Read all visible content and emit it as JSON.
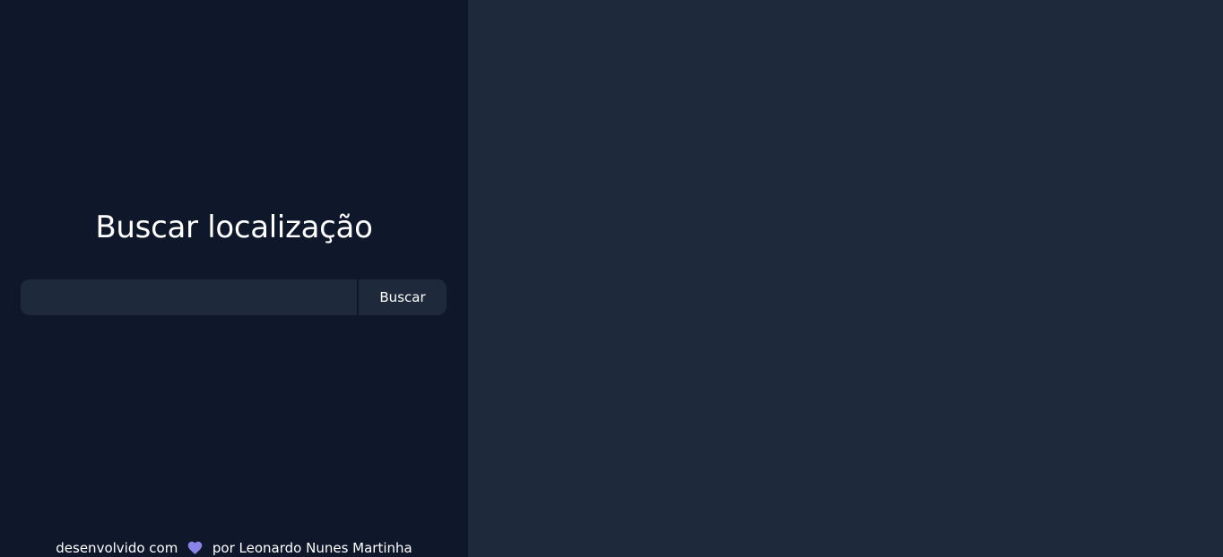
{
  "colors": {
    "sidebar_background": "#0f172a",
    "main_background": "#1e293b",
    "input_background": "#1e293b",
    "text": "#ffffff",
    "heart": "#8b83e8"
  },
  "sidebar": {
    "title": "Buscar localização",
    "search": {
      "value": "",
      "placeholder": "",
      "button_label": "Buscar"
    }
  },
  "footer": {
    "prefix": "desenvolvido com",
    "icon": "heart-icon",
    "suffix": "por Leonardo Nunes Martinha"
  }
}
